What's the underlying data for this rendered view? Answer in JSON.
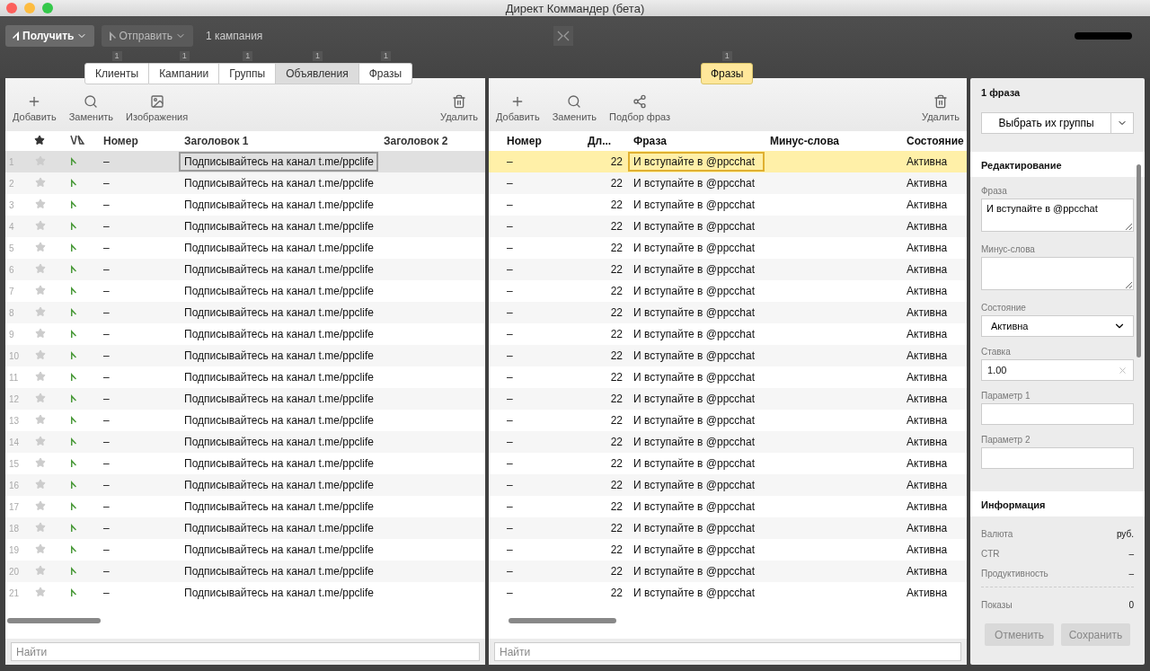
{
  "window": {
    "title": "Директ Коммандер (бета)"
  },
  "toolbar": {
    "get_button": "Получить",
    "send_button": "Отправить",
    "campaigns": "1 кампания"
  },
  "tabs": [
    {
      "label": "Клиенты",
      "count": "1",
      "selected": false
    },
    {
      "label": "Кампании",
      "count": "1",
      "selected": false
    },
    {
      "label": "Группы",
      "count": "1",
      "selected": false
    },
    {
      "label": "Объявления",
      "count": "1",
      "selected": true
    },
    {
      "label": "Фразы",
      "count": "1",
      "selected": false
    }
  ],
  "ads_panel": {
    "tools": [
      {
        "kind": "add",
        "label": "Добавить"
      },
      {
        "kind": "replace",
        "label": "Заменить"
      },
      {
        "kind": "images",
        "label": "Изображения"
      },
      {
        "kind": "delete",
        "label": "Удалить"
      }
    ],
    "columns": [
      "Номер",
      "Заголовок 1",
      "Заголовок 2"
    ],
    "rows": [
      {
        "n": "1",
        "number": "–",
        "title1": "Подписывайтесь на канал t.me/ppclife",
        "starred": false,
        "selected": true
      },
      {
        "n": "2",
        "number": "–",
        "title1": "Подписывайтесь на канал t.me/ppclife",
        "starred": false,
        "selected": false
      },
      {
        "n": "3",
        "number": "–",
        "title1": "Подписывайтесь на канал t.me/ppclife",
        "starred": false,
        "selected": false
      },
      {
        "n": "4",
        "number": "–",
        "title1": "Подписывайтесь на канал t.me/ppclife",
        "starred": false,
        "selected": false
      },
      {
        "n": "5",
        "number": "–",
        "title1": "Подписывайтесь на канал t.me/ppclife",
        "starred": false,
        "selected": false
      },
      {
        "n": "6",
        "number": "–",
        "title1": "Подписывайтесь на канал t.me/ppclife",
        "starred": false,
        "selected": false
      },
      {
        "n": "7",
        "number": "–",
        "title1": "Подписывайтесь на канал t.me/ppclife",
        "starred": false,
        "selected": false
      },
      {
        "n": "8",
        "number": "–",
        "title1": "Подписывайтесь на канал t.me/ppclife",
        "starred": false,
        "selected": false
      },
      {
        "n": "9",
        "number": "–",
        "title1": "Подписывайтесь на канал t.me/ppclife",
        "starred": false,
        "selected": false
      },
      {
        "n": "10",
        "number": "–",
        "title1": "Подписывайтесь на канал t.me/ppclife",
        "starred": false,
        "selected": false
      },
      {
        "n": "11",
        "number": "–",
        "title1": "Подписывайтесь на канал t.me/ppclife",
        "starred": false,
        "selected": false
      },
      {
        "n": "12",
        "number": "–",
        "title1": "Подписывайтесь на канал t.me/ppclife",
        "starred": false,
        "selected": false
      },
      {
        "n": "13",
        "number": "–",
        "title1": "Подписывайтесь на канал t.me/ppclife",
        "starred": false,
        "selected": false
      },
      {
        "n": "14",
        "number": "–",
        "title1": "Подписывайтесь на канал t.me/ppclife",
        "starred": false,
        "selected": false
      },
      {
        "n": "15",
        "number": "–",
        "title1": "Подписывайтесь на канал t.me/ppclife",
        "starred": false,
        "selected": false
      },
      {
        "n": "16",
        "number": "–",
        "title1": "Подписывайтесь на канал t.me/ppclife",
        "starred": false,
        "selected": false
      },
      {
        "n": "17",
        "number": "–",
        "title1": "Подписывайтесь на канал t.me/ppclife",
        "starred": false,
        "selected": false
      },
      {
        "n": "18",
        "number": "–",
        "title1": "Подписывайтесь на канал t.me/ppclife",
        "starred": false,
        "selected": false
      },
      {
        "n": "19",
        "number": "–",
        "title1": "Подписывайтесь на канал t.me/ppclife",
        "starred": false,
        "selected": false
      },
      {
        "n": "20",
        "number": "–",
        "title1": "Подписывайтесь на канал t.me/ppclife",
        "starred": false,
        "selected": false
      },
      {
        "n": "21",
        "number": "–",
        "title1": "Подписывайтесь на канал t.me/ppclife",
        "starred": false,
        "selected": false
      }
    ],
    "search": {
      "placeholder": "Найти"
    }
  },
  "phrases_panel": {
    "tab": {
      "label": "Фразы",
      "count": "1",
      "selected": true
    },
    "tools": [
      {
        "kind": "add",
        "label": "Добавить"
      },
      {
        "kind": "replace",
        "label": "Заменить"
      },
      {
        "kind": "pick",
        "label": "Подбор фраз"
      },
      {
        "kind": "delete",
        "label": "Удалить"
      }
    ],
    "columns": [
      "Номер",
      "Дл...",
      "Фраза",
      "Минус-слова",
      "Состояние"
    ],
    "rows": [
      {
        "number": "–",
        "length": "22",
        "phrase": "И вступайте в @ppcchat",
        "state": "Активна",
        "selected": true
      },
      {
        "number": "–",
        "length": "22",
        "phrase": "И вступайте в @ppcchat",
        "state": "Активна",
        "selected": false
      },
      {
        "number": "–",
        "length": "22",
        "phrase": "И вступайте в @ppcchat",
        "state": "Активна",
        "selected": false
      },
      {
        "number": "–",
        "length": "22",
        "phrase": "И вступайте в @ppcchat",
        "state": "Активна",
        "selected": false
      },
      {
        "number": "–",
        "length": "22",
        "phrase": "И вступайте в @ppcchat",
        "state": "Активна",
        "selected": false
      },
      {
        "number": "–",
        "length": "22",
        "phrase": "И вступайте в @ppcchat",
        "state": "Активна",
        "selected": false
      },
      {
        "number": "–",
        "length": "22",
        "phrase": "И вступайте в @ppcchat",
        "state": "Активна",
        "selected": false
      },
      {
        "number": "–",
        "length": "22",
        "phrase": "И вступайте в @ppcchat",
        "state": "Активна",
        "selected": false
      },
      {
        "number": "–",
        "length": "22",
        "phrase": "И вступайте в @ppcchat",
        "state": "Активна",
        "selected": false
      },
      {
        "number": "–",
        "length": "22",
        "phrase": "И вступайте в @ppcchat",
        "state": "Активна",
        "selected": false
      },
      {
        "number": "–",
        "length": "22",
        "phrase": "И вступайте в @ppcchat",
        "state": "Активна",
        "selected": false
      },
      {
        "number": "–",
        "length": "22",
        "phrase": "И вступайте в @ppcchat",
        "state": "Активна",
        "selected": false
      },
      {
        "number": "–",
        "length": "22",
        "phrase": "И вступайте в @ppcchat",
        "state": "Активна",
        "selected": false
      },
      {
        "number": "–",
        "length": "22",
        "phrase": "И вступайте в @ppcchat",
        "state": "Активна",
        "selected": false
      },
      {
        "number": "–",
        "length": "22",
        "phrase": "И вступайте в @ppcchat",
        "state": "Активна",
        "selected": false
      },
      {
        "number": "–",
        "length": "22",
        "phrase": "И вступайте в @ppcchat",
        "state": "Активна",
        "selected": false
      },
      {
        "number": "–",
        "length": "22",
        "phrase": "И вступайте в @ppcchat",
        "state": "Активна",
        "selected": false
      },
      {
        "number": "–",
        "length": "22",
        "phrase": "И вступайте в @ppcchat",
        "state": "Активна",
        "selected": false
      },
      {
        "number": "–",
        "length": "22",
        "phrase": "И вступайте в @ppcchat",
        "state": "Активна",
        "selected": false
      },
      {
        "number": "–",
        "length": "22",
        "phrase": "И вступайте в @ppcchat",
        "state": "Активна",
        "selected": false
      },
      {
        "number": "–",
        "length": "22",
        "phrase": "И вступайте в @ppcchat",
        "state": "Активна",
        "selected": false
      }
    ],
    "search": {
      "placeholder": "Найти"
    }
  },
  "details": {
    "title": "1 фраза",
    "select_groups": "Выбрать их группы",
    "editing": {
      "title": "Редактирование",
      "fields": [
        {
          "kind": "textarea",
          "label": "Фраза",
          "value": "И вступайте в @ppcchat"
        },
        {
          "kind": "textarea",
          "label": "Минус-слова"
        },
        {
          "kind": "select",
          "label": "Состояние",
          "value": "Активна"
        },
        {
          "kind": "clearable",
          "label": "Ставка",
          "value": "1.00"
        },
        {
          "kind": "input",
          "label": "Параметр 1"
        },
        {
          "kind": "input",
          "label": "Параметр 2"
        }
      ]
    },
    "info": {
      "title": "Информация",
      "rows": [
        {
          "label": "Валюта",
          "value": "руб."
        },
        {
          "label": "CTR",
          "value": "–"
        },
        {
          "label": "Продуктивность",
          "value": "–"
        }
      ],
      "totals": [
        {
          "label": "Показы",
          "value": "0"
        }
      ]
    },
    "buttons": [
      {
        "label": "Отменить",
        "disabled": true
      },
      {
        "label": "Сохранить",
        "disabled": true
      }
    ]
  }
}
